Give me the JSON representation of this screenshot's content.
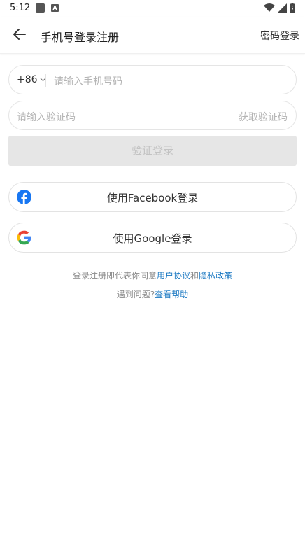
{
  "status": {
    "time": "5:12"
  },
  "header": {
    "title": "手机号登录注册",
    "password_login": "密码登录"
  },
  "phone": {
    "country_code": "+86",
    "placeholder": "请输入手机号码"
  },
  "code": {
    "placeholder": "请输入验证码",
    "get_code": "获取验证码"
  },
  "login_button": "验证登录",
  "oauth": {
    "facebook": "使用Facebook登录",
    "google": "使用Google登录"
  },
  "agreement": {
    "prefix": "登录注册即代表你同意",
    "user_agreement": "用户协议",
    "and": "和",
    "privacy_policy": "隐私政策"
  },
  "help": {
    "prefix": "遇到问题?",
    "link": "查看帮助"
  },
  "colors": {
    "link": "#1a78c2",
    "facebook": "#1877f2",
    "disabled_button": "#e6e6e6"
  }
}
